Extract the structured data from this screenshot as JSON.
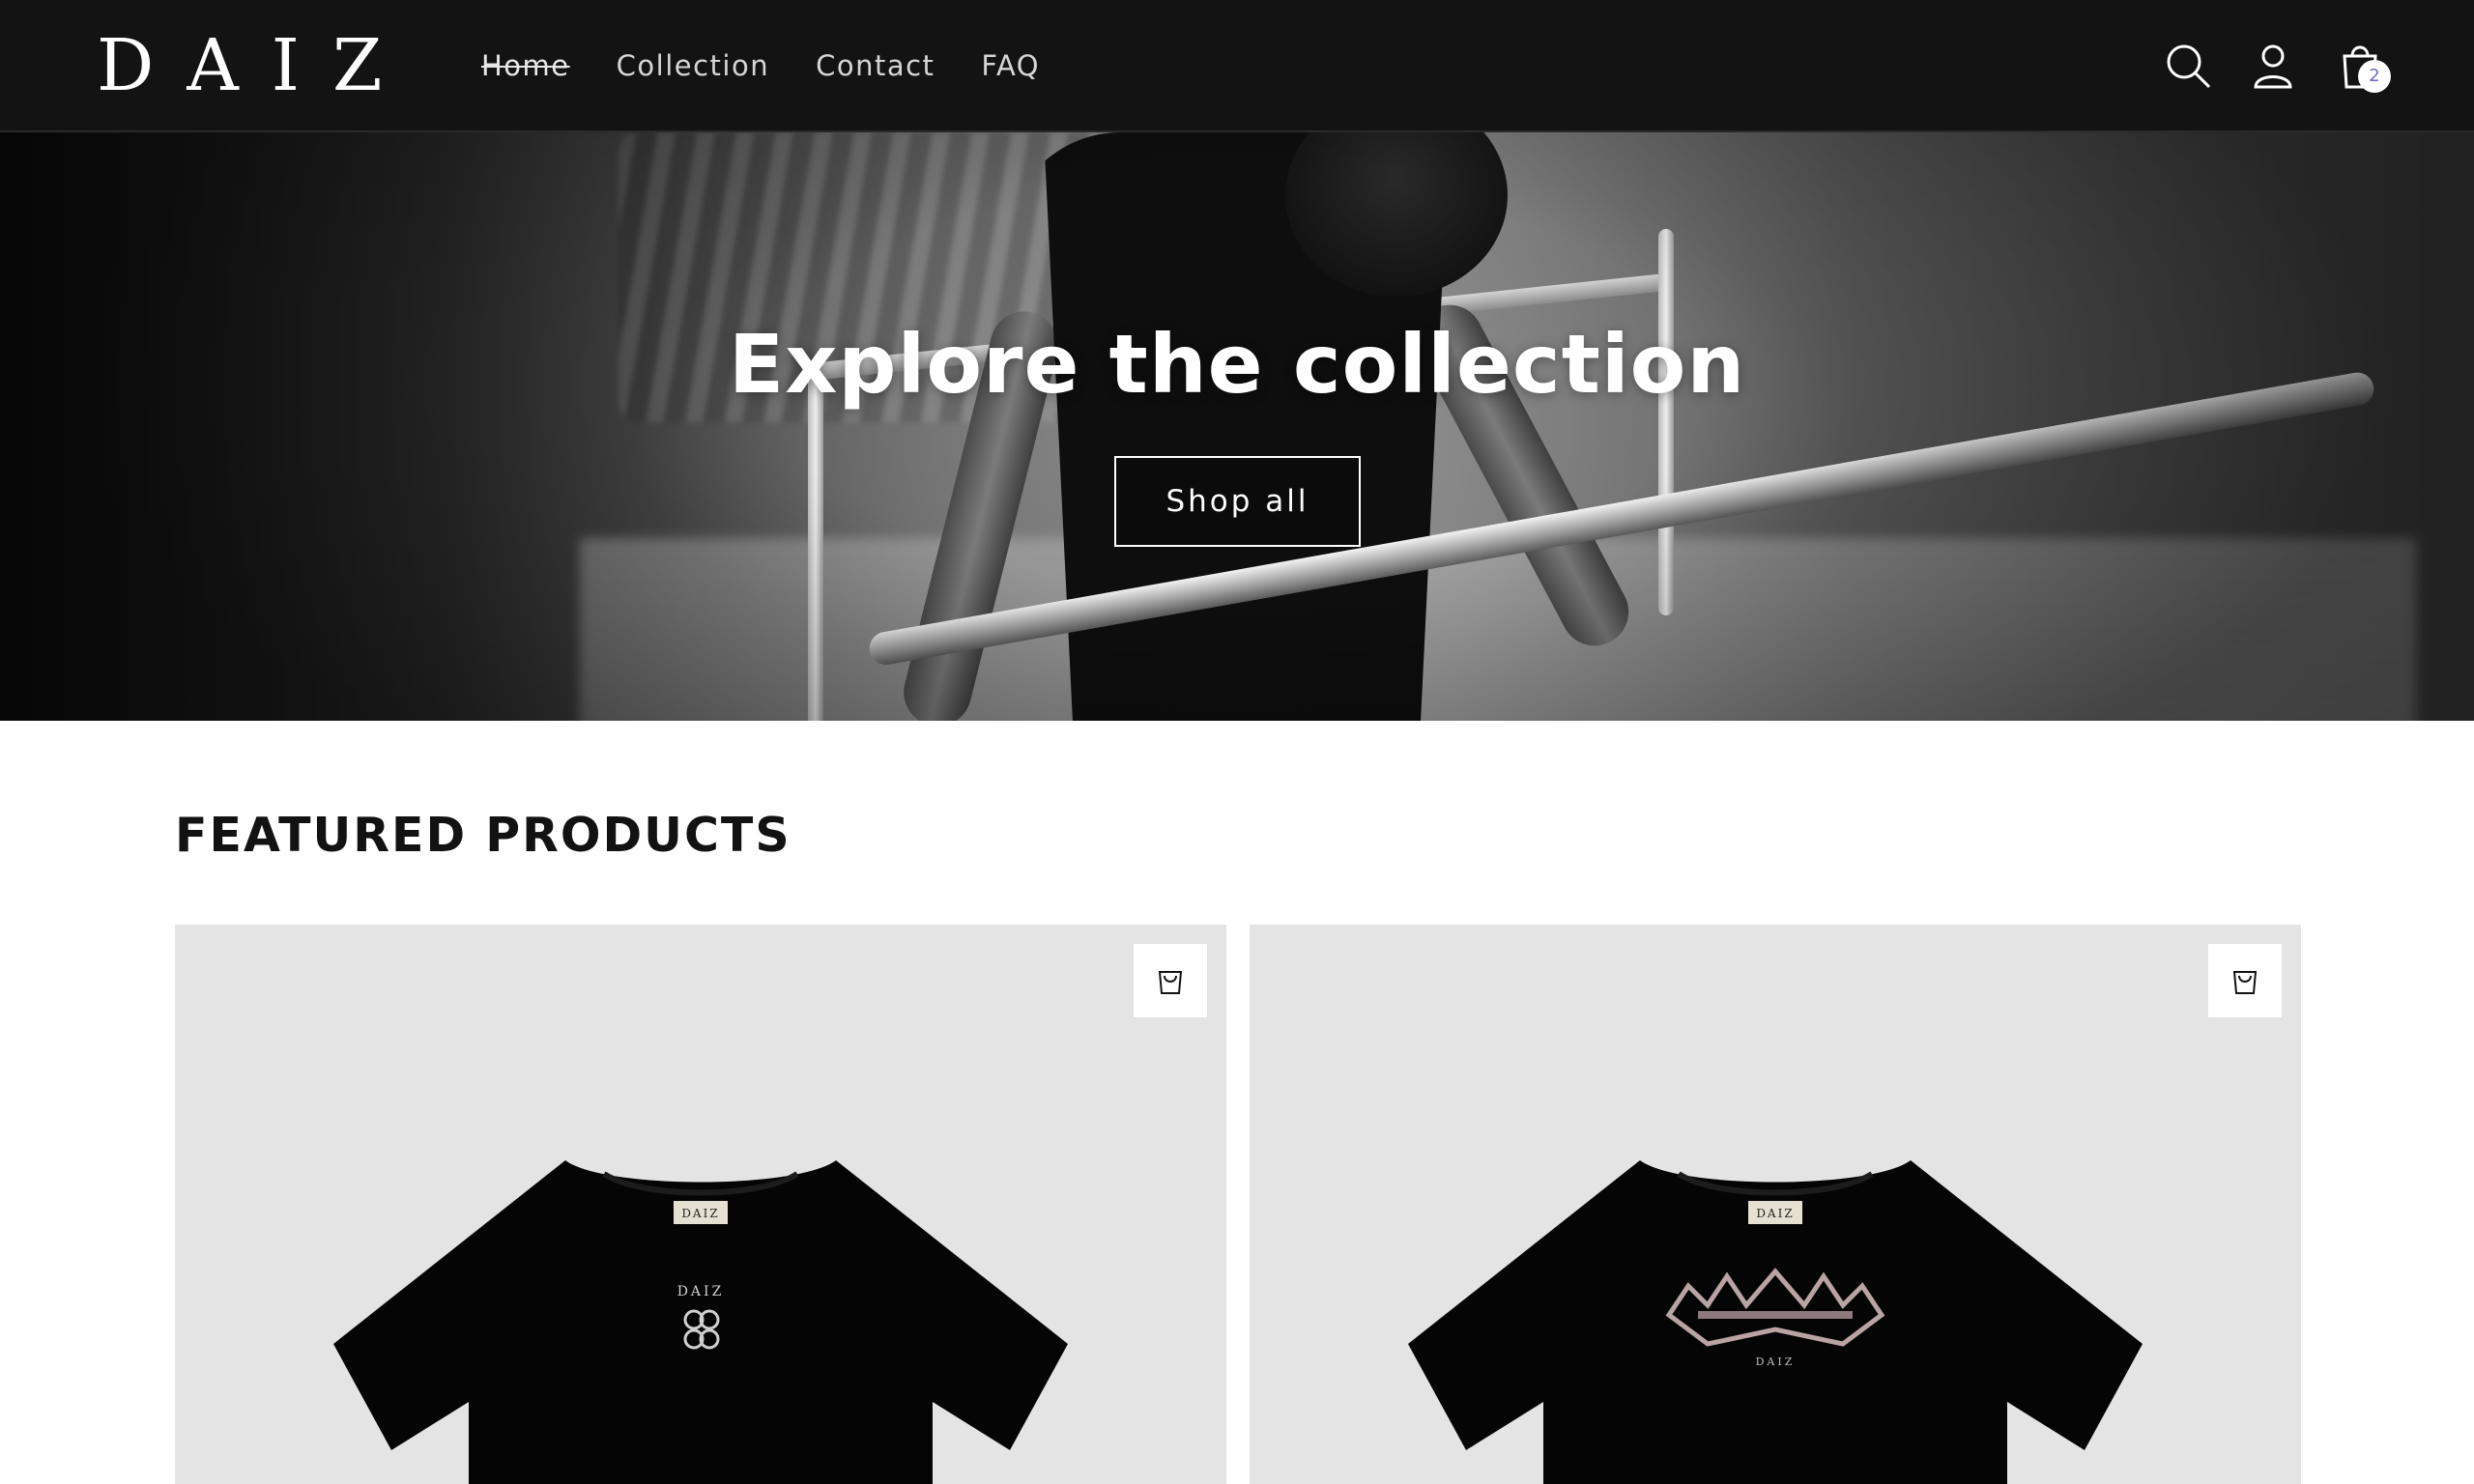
{
  "header": {
    "logo": "DAIZ",
    "nav": [
      {
        "label": "Home",
        "active": true
      },
      {
        "label": "Collection",
        "active": false
      },
      {
        "label": "Contact",
        "active": false
      },
      {
        "label": "FAQ",
        "active": false
      }
    ],
    "icons": [
      "search-icon",
      "account-icon",
      "cart-icon"
    ],
    "cart_count": "2"
  },
  "hero": {
    "title": "Explore the collection",
    "button_label": "Shop all"
  },
  "featured": {
    "title": "FEATURED PRODUCTS",
    "products": [
      {
        "name": "product-card-1",
        "quick_add_icon": "bag-icon"
      },
      {
        "name": "product-card-2",
        "quick_add_icon": "bag-icon"
      }
    ]
  },
  "colors": {
    "header_bg": "#131313",
    "card_bg": "#e4e4e4",
    "text": "#121212",
    "cart_badge_text": "#6b6bcf"
  }
}
